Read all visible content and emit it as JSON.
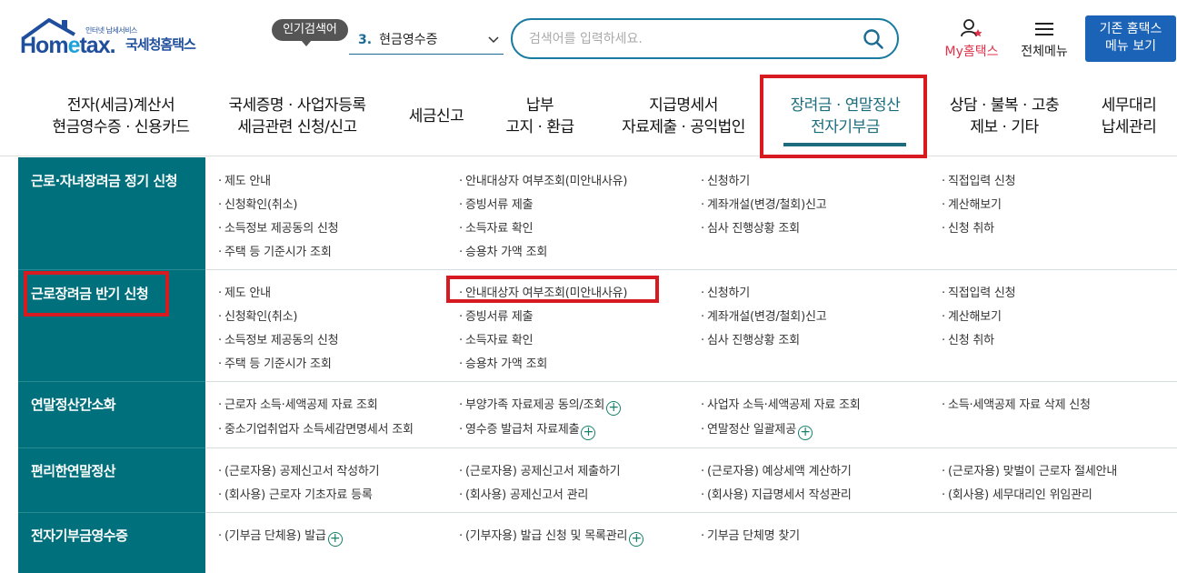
{
  "header": {
    "logo_sub": "인터넷 납세서비스",
    "logo_main_1": "Hom",
    "logo_main_e": "e",
    "logo_main_2": "tax.",
    "logo_kor": "국세청홈택스",
    "popular_badge": "인기검색어",
    "popular_num": "3.",
    "popular_value": "현금영수증",
    "search_placeholder": "검색어를 입력하세요.",
    "myhome_label": "My홈택스",
    "allmenu_label": "전체메뉴",
    "old_button_line1": "기존 홈택스",
    "old_button_line2": "메뉴 보기"
  },
  "colors": {
    "brand": "#1f4e9c",
    "teal": "#00707c",
    "highlight": "#d71920",
    "button": "#1b63b6"
  },
  "gnb": [
    {
      "line1": "전자(세금)계산서",
      "line2": "현금영수증 · 신용카드"
    },
    {
      "line1": "국세증명 · 사업자등록",
      "line2": "세금관련 신청/신고"
    },
    {
      "line1": "세금신고",
      "line2": ""
    },
    {
      "line1": "납부",
      "line2": "고지 · 환급"
    },
    {
      "line1": "지급명세서",
      "line2": "자료제출 · 공익법인"
    },
    {
      "line1": "장려금 · 연말정산",
      "line2": "전자기부금"
    },
    {
      "line1": "상담 · 불복 · 고충",
      "line2": "제보 · 기타"
    },
    {
      "line1": "세무대리",
      "line2": "납세관리"
    }
  ],
  "sections": [
    {
      "title": "근로·자녀장려금 정기 신청",
      "cols": [
        [
          "제도 안내",
          "신청확인(취소)",
          "소득정보 제공동의 신청",
          "주택 등 기준시가 조회"
        ],
        [
          "안내대상자 여부조회(미안내사유)",
          "증빙서류 제출",
          "소득자료 확인",
          "승용차 가액 조회"
        ],
        [
          "신청하기",
          "계좌개설(변경/철회)신고",
          "심사 진행상황 조회"
        ],
        [
          "직접입력 신청",
          "계산해보기",
          "신청 취하"
        ]
      ]
    },
    {
      "title": "근로장려금 반기 신청",
      "cols": [
        [
          "제도 안내",
          "신청확인(취소)",
          "소득정보 제공동의 신청",
          "주택 등 기준시가 조회"
        ],
        [
          "안내대상자 여부조회(미안내사유)",
          "증빙서류 제출",
          "소득자료 확인",
          "승용차 가액 조회"
        ],
        [
          "신청하기",
          "계좌개설(변경/철회)신고",
          "심사 진행상황 조회"
        ],
        [
          "직접입력 신청",
          "계산해보기",
          "신청 취하"
        ]
      ]
    },
    {
      "title": "연말정산간소화",
      "cols": [
        [
          "근로자 소득·세액공제 자료 조회",
          "중소기업취업자 소득세감면명세서 조회"
        ],
        [
          "부양가족 자료제공 동의/조회",
          "영수증 발급처 자료제출"
        ],
        [
          "사업자 소득·세액공제 자료 조회",
          "연말정산 일괄제공"
        ],
        [
          "소득·세액공제 자료 삭제 신청"
        ]
      ]
    },
    {
      "title": "편리한연말정산",
      "cols": [
        [
          "(근로자용) 공제신고서 작성하기",
          "(회사용) 근로자 기초자료 등록"
        ],
        [
          "(근로자용) 공제신고서 제출하기",
          "(회사용) 공제신고서 관리"
        ],
        [
          "(근로자용) 예상세액 계산하기",
          "(회사용) 지급명세서 작성관리"
        ],
        [
          "(근로자용) 맞벌이 근로자 절세안내",
          "(회사용) 세무대리인 위임관리"
        ]
      ]
    },
    {
      "title": "전자기부금영수증",
      "cols": [
        [
          "(기부금 단체용) 발급"
        ],
        [
          "(기부자용) 발급 신청 및 목록관리"
        ],
        [
          "기부금 단체명 찾기"
        ],
        []
      ]
    }
  ]
}
